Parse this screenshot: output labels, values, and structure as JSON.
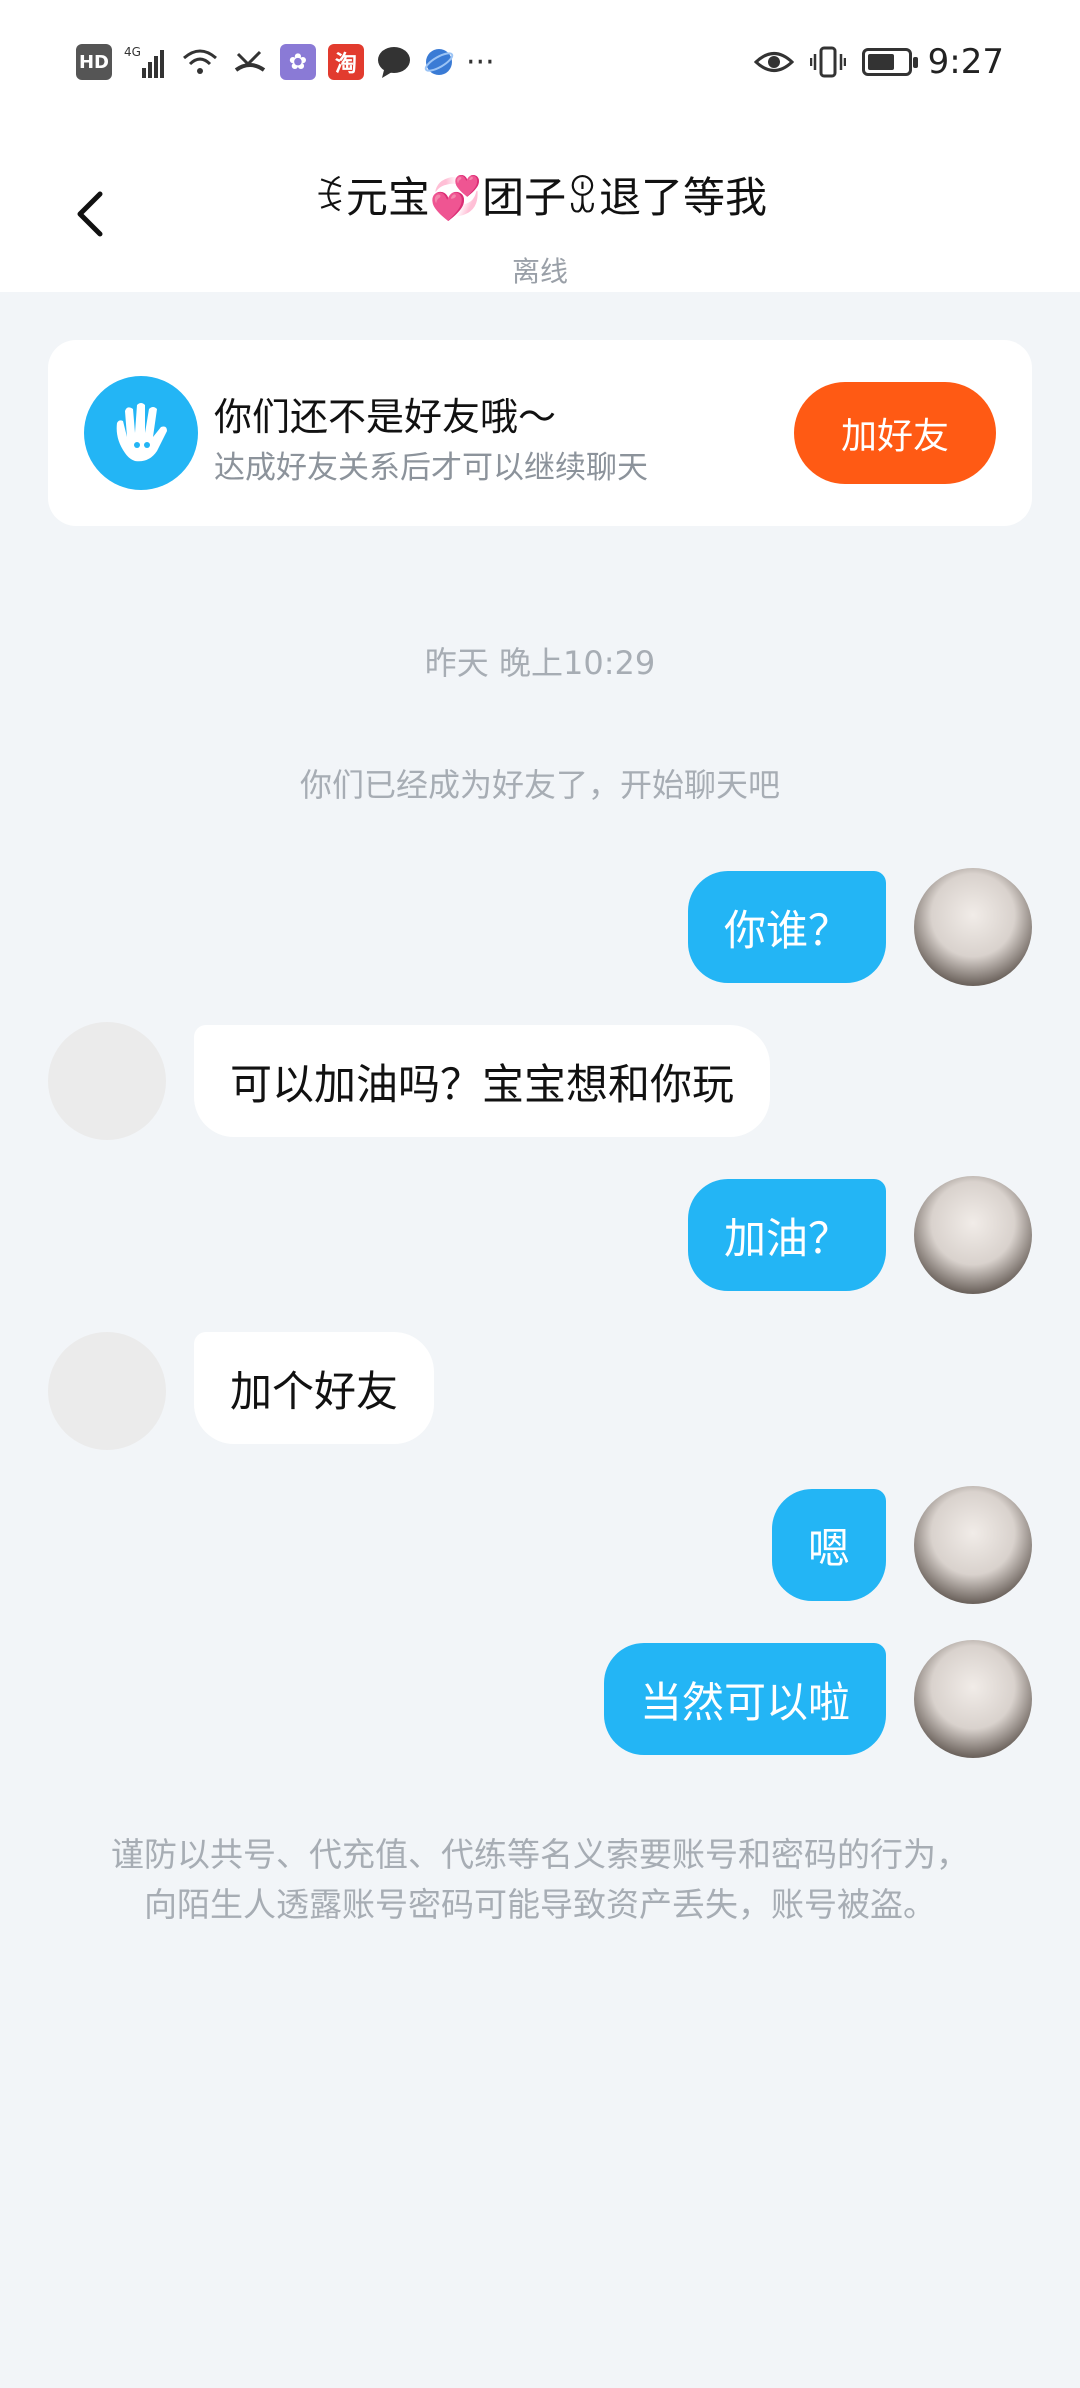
{
  "status_bar": {
    "left_icons": [
      "hd-icon",
      "signal-4g-icon",
      "wifi-icon",
      "missed-call-icon",
      "app-icon",
      "taobao-icon",
      "message-icon",
      "browser-icon",
      "more-dots-icon"
    ],
    "more": "···",
    "time": "9:27"
  },
  "header": {
    "title": "ꉂ元宝💞团子ꀾ退了等我",
    "status": "离线"
  },
  "friend_card": {
    "title": "你们还不是好友哦～",
    "subtitle": "达成好友关系后才可以继续聊天",
    "button": "加好友"
  },
  "chat": {
    "timestamp": "昨天 晚上10:29",
    "system_message": "你们已经成为好友了，开始聊天吧",
    "messages": [
      {
        "side": "me",
        "text": "你谁？"
      },
      {
        "side": "them",
        "text": "可以加油吗？宝宝想和你玩"
      },
      {
        "side": "me",
        "text": "加油？"
      },
      {
        "side": "them",
        "text": "加个好友"
      },
      {
        "side": "me",
        "text": "嗯"
      },
      {
        "side": "me",
        "text": "当然可以啦"
      }
    ]
  },
  "warning": "谨防以共号、代充值、代练等名义索要账号和密码的行为，向陌生人透露账号密码可能导致资产丢失，账号被盗。",
  "colors": {
    "accent": "#23b5f5",
    "add_button": "#ff5a14",
    "background": "#f2f5f8"
  }
}
